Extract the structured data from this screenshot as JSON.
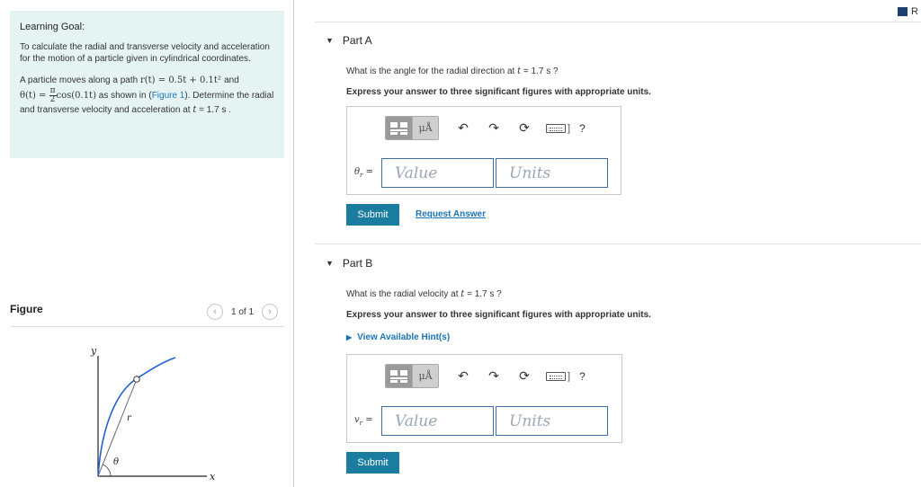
{
  "learning_goal": {
    "title": "Learning Goal:",
    "text": "To calculate the radial and transverse velocity and acceleration for the motion of a particle given in cylindrical coordinates.",
    "problem_pre": "A particle moves along a path ",
    "r_expr": "r(t) = 0.5t + 0.1t² ",
    "and": "and",
    "theta_lhs": "θ(t) = ",
    "frac_num": "π",
    "frac_den": "2",
    "theta_rhs": "cos(0.1t)",
    "shown_in": " as shown in (",
    "figure_link": "Figure 1",
    "determine": "). Determine the radial and transverse velocity and acceleration at ",
    "t_var": "t",
    "t_value": " = 1.7 s ."
  },
  "figure": {
    "label": "Figure",
    "pager_text": "1 of 1",
    "prev_icon": "chevron-left-icon",
    "next_icon": "chevron-right-icon",
    "axis_y": "y",
    "axis_x": "x",
    "label_r": "r",
    "label_theta": "θ"
  },
  "header": {
    "badge_text": "R"
  },
  "partA": {
    "title": "Part A",
    "question_pre": "What is the angle for the radial direction at ",
    "t_var": "t",
    "question_post": " = 1.7 s ?",
    "instructions": "Express your answer to three significant figures with appropriate units.",
    "answer_label": "θ",
    "answer_sub": "r",
    "answer_eq": " =",
    "value_placeholder": "Value",
    "units_placeholder": "Units",
    "submit_label": "Submit",
    "request_label": "Request Answer"
  },
  "partB": {
    "title": "Part B",
    "question_pre": "What is the radial velocity at ",
    "t_var": "t",
    "question_post": " = 1.7 s ?",
    "instructions": "Express your answer to three significant figures with appropriate units.",
    "hint_label": "View Available Hint(s)",
    "answer_label": "v",
    "answer_sub": "r",
    "answer_eq": " =",
    "value_placeholder": "Value",
    "units_placeholder": "Units",
    "submit_label": "Submit"
  },
  "toolbar": {
    "units_btn": "μÅ",
    "help": "?",
    "bracket": "]",
    "icons": [
      "templates-icon",
      "units-icon",
      "undo-icon",
      "redo-icon",
      "reset-icon",
      "keyboard-icon",
      "help-icon"
    ]
  },
  "colors": {
    "goal_bg": "#e6f3f3",
    "link": "#1a74b4",
    "submit_bg": "#1a7c9e",
    "field_border": "#3a6ea5",
    "curve": "#1f5fd6"
  }
}
